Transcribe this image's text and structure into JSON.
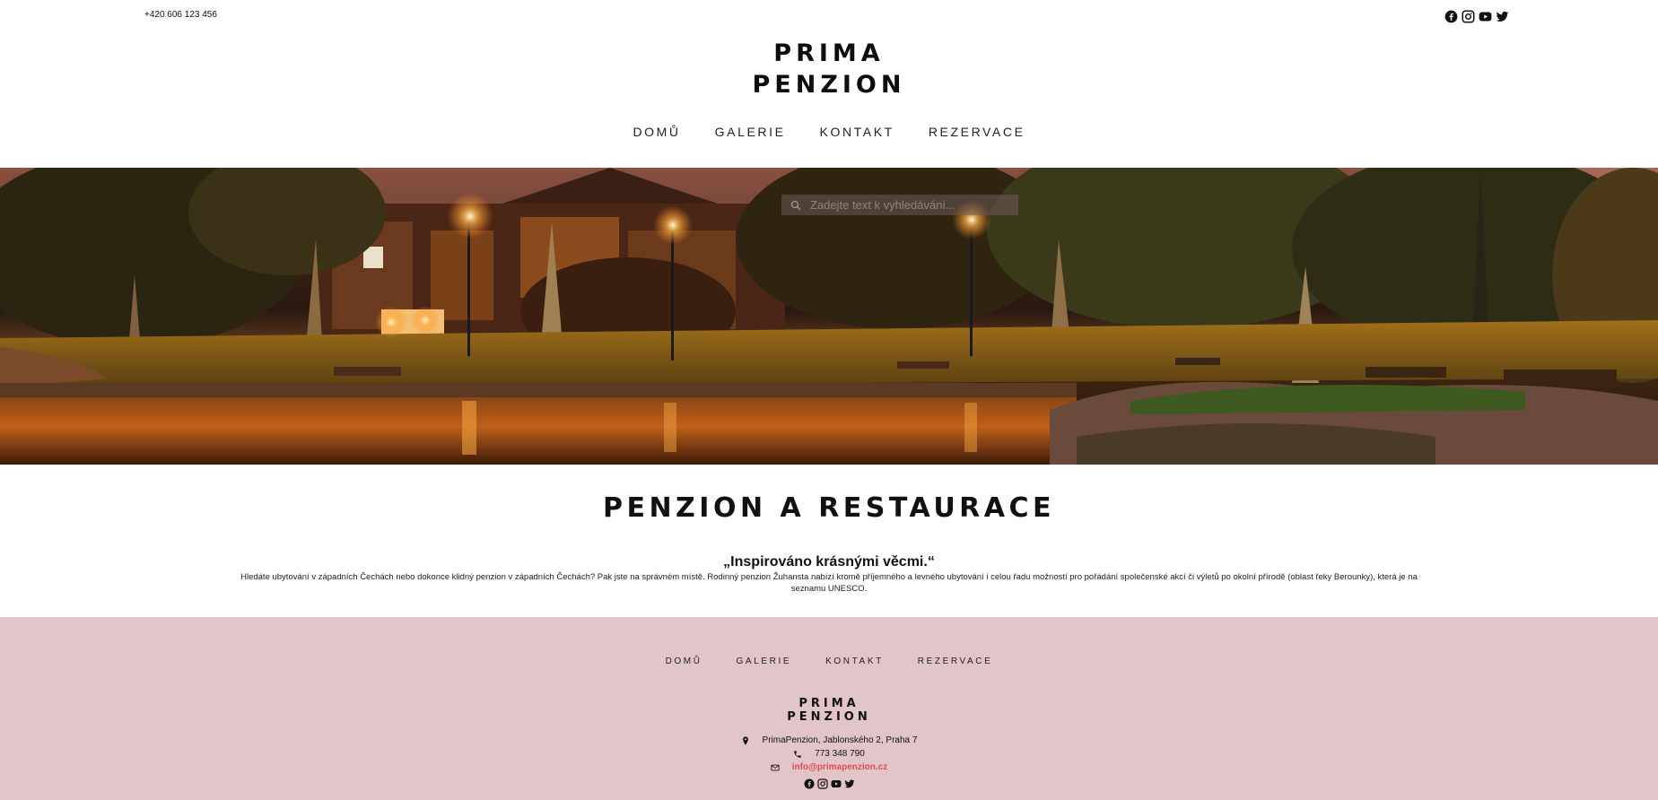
{
  "header": {
    "phone": "+420 606 123 456",
    "logo_line1": "PRIMA",
    "logo_line2": "PENZION",
    "social_icons": [
      "facebook-icon",
      "instagram-icon",
      "youtube-icon",
      "twitter-icon"
    ]
  },
  "nav": {
    "items": [
      {
        "label": "DOMŮ"
      },
      {
        "label": "GALERIE"
      },
      {
        "label": "KONTAKT"
      },
      {
        "label": "REZERVACE"
      }
    ]
  },
  "hero": {
    "search_placeholder": "Zadejte text k vyhledávání..."
  },
  "main": {
    "heading": "PENZION A RESTAURACE",
    "quote": "„Inspirováno krásnými věcmi.“",
    "description": "Hledáte ubytování v západních Čechách nebo dokonce klidný penzion v západních Čechách? Pak jste na správném místě. Rodinný penzion Žuhansta nabízí kromě příjemného a levného ubytování i celou řadu možností pro pořádání společenské akcí či výletů po okolní přírodě (oblast řeky Berounky), která je na seznamu UNESCO."
  },
  "footer": {
    "nav": [
      {
        "label": "DOMŮ"
      },
      {
        "label": "GALERIE"
      },
      {
        "label": "KONTAKT"
      },
      {
        "label": "REZERVACE"
      }
    ],
    "logo_line1": "PRIMA",
    "logo_line2": "PENZION",
    "address": "PrimaPenzion, Jablonského 2, Praha 7",
    "phone": "773 348 790",
    "email": "info@primapenzion.cz",
    "background_color": "#e1c5c8",
    "email_color": "#e04a55"
  }
}
